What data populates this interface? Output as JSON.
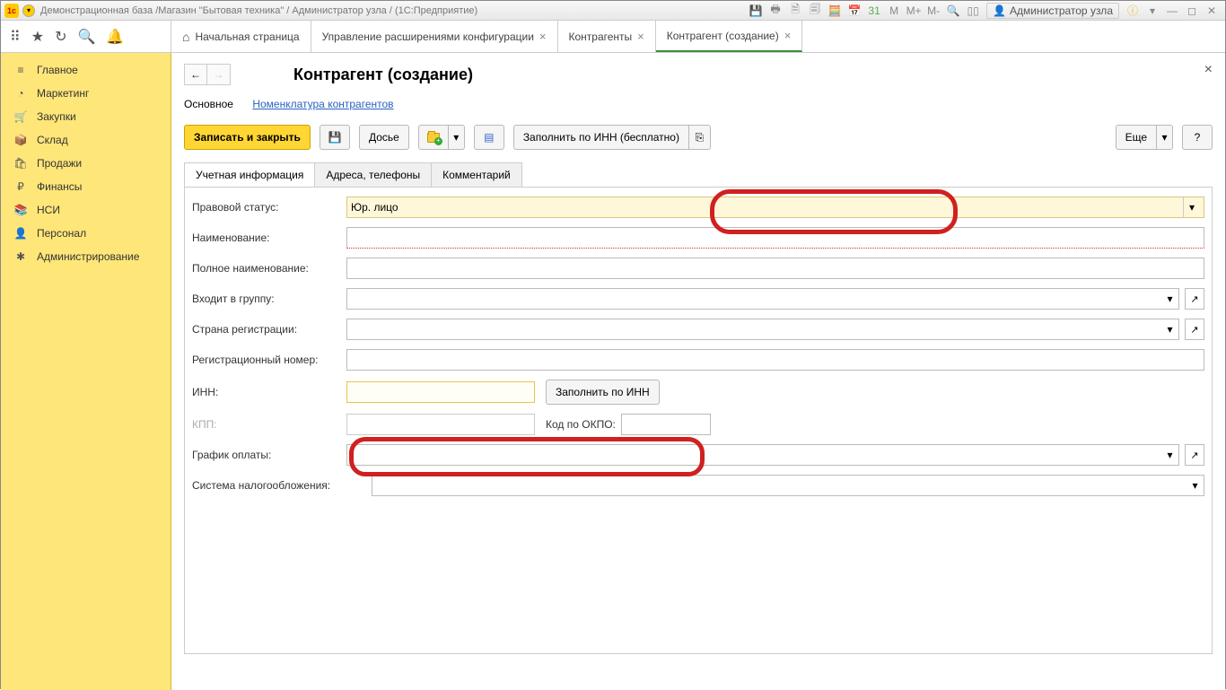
{
  "titlebar": {
    "text": "Демонстрационная база /Магазин \"Бытовая техника\" / Администратор узла /  (1С:Предприятие)",
    "user": "Администратор узла",
    "m_labels": [
      "M",
      "M+",
      "M-"
    ]
  },
  "top_tabs": {
    "home": "Начальная страница",
    "items": [
      {
        "label": "Управление расширениями конфигурации"
      },
      {
        "label": "Контрагенты"
      },
      {
        "label": "Контрагент (создание)",
        "active": true
      }
    ]
  },
  "sidebar": {
    "items": [
      {
        "icon": "≡",
        "label": "Главное"
      },
      {
        "icon": "◔",
        "label": "Маркетинг"
      },
      {
        "icon": "🛒",
        "label": "Закупки"
      },
      {
        "icon": "📦",
        "label": "Склад"
      },
      {
        "icon": "🛍",
        "label": "Продажи"
      },
      {
        "icon": "₽",
        "label": "Финансы"
      },
      {
        "icon": "📚",
        "label": "НСИ"
      },
      {
        "icon": "👤",
        "label": "Персонал"
      },
      {
        "icon": "✱",
        "label": "Администрирование"
      }
    ]
  },
  "page": {
    "title": "Контрагент (создание)",
    "subnav": {
      "main": "Основное",
      "link": "Номенклатура контрагентов"
    }
  },
  "toolbar": {
    "save_close": "Записать и закрыть",
    "dossier": "Досье",
    "fill_inn_free": "Заполнить по ИНН (бесплатно)",
    "more": "Еще",
    "help": "?"
  },
  "form_tabs": {
    "t1": "Учетная информация",
    "t2": "Адреса, телефоны",
    "t3": "Комментарий"
  },
  "form": {
    "legal_status_label": "Правовой статус:",
    "legal_status_value": "Юр. лицо",
    "name_label": "Наименование:",
    "full_name_label": "Полное наименование:",
    "group_label": "Входит в группу:",
    "country_label": "Страна регистрации:",
    "reg_num_label": "Регистрационный номер:",
    "inn_label": "ИНН:",
    "fill_inn_btn": "Заполнить по ИНН",
    "kpp_label": "КПП:",
    "okpo_label": "Код по ОКПО:",
    "payment_schedule_label": "График оплаты:",
    "tax_system_label": "Система налогообложения:"
  }
}
